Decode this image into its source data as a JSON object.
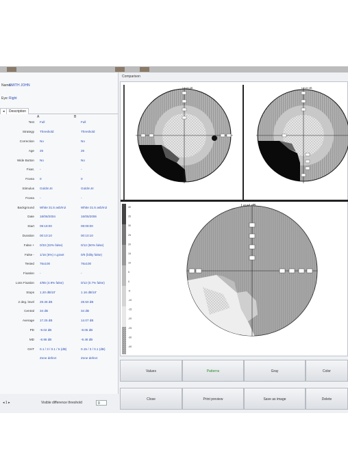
{
  "patient": {
    "name_label": "Name:",
    "name_value": "SMITH JOHN",
    "eye_label": "Eye:",
    "eye_value": "Right"
  },
  "tabs": {
    "first": "◂",
    "description": "Description"
  },
  "columns": {
    "a": "A",
    "b": "B"
  },
  "rows": [
    {
      "key": "Test",
      "a": "Full",
      "b": "Full"
    },
    {
      "key": "Strategy",
      "a": "Threshold",
      "b": "Threshold"
    },
    {
      "key": "Correction",
      "a": "No",
      "b": "No"
    },
    {
      "key": "Age",
      "a": "25",
      "b": "26"
    },
    {
      "key": "Wide Button",
      "a": "No",
      "b": "No"
    },
    {
      "key": "Fixat.",
      "a": "-",
      "b": "-"
    },
    {
      "key": "Fovea",
      "a": "0",
      "b": "0"
    },
    {
      "key": "Stimulus",
      "a": "Goldm.III",
      "b": "Goldm.III"
    },
    {
      "key": "Fovea",
      "a": "-",
      "b": "-"
    },
    {
      "key": "Background",
      "a": "White 31.5 asb/m2",
      "b": "White 31.5 asb/m2"
    },
    {
      "key": "Date",
      "a": "18/06/2004",
      "b": "16/05/2006"
    },
    {
      "key": "Start",
      "a": "09:18:00",
      "b": "09:08:00"
    },
    {
      "key": "Duration",
      "a": "00:10:10",
      "b": "00:10:10"
    },
    {
      "key": "False +",
      "a": "0/33 (33% false)",
      "b": "0/12 (50% false)"
    },
    {
      "key": "False -",
      "a": "1/16 (6%) n.grant",
      "b": "0/6 (bility false)"
    },
    {
      "key": "Tested",
      "a": "76x100",
      "b": "76x100"
    },
    {
      "key": "Fixation",
      "a": "-",
      "b": "-"
    },
    {
      "key": "Loss Fixation",
      "a": "4/85 (4.9% false)",
      "b": "0/12 (0.7% false)"
    },
    {
      "key": "Stops",
      "a": "1.20 dB/10'",
      "b": "1.16 dB/10'"
    },
    {
      "key": "2 deg. level",
      "a": "29.36 dB",
      "b": "28.50 dB"
    },
    {
      "key": "Central",
      "a": "34 dB",
      "b": "34 dB"
    },
    {
      "key": "Average",
      "a": "17.25 dB",
      "b": "14.07 dB"
    },
    {
      "key": "PD",
      "a": "-9.02 dB",
      "b": "-8.05 dB"
    },
    {
      "key": "MD",
      "a": "-8.98 dB",
      "b": "-9.48 dB"
    },
    {
      "key": "GHT",
      "a": "0.1 / 3 / 0.1 / 5 (dB)",
      "b": "0.15 / 3 / 0.1 (dB)"
    },
    {
      "key": "",
      "a": "Zone defect",
      "b": "Zone defect"
    }
  ],
  "left_footer": {
    "nav": "◂ 1 ▸",
    "threshold_label": "Visible difference threshold",
    "threshold_value": "0"
  },
  "comparison_title": "Comparison",
  "charts": {
    "top_left_title": "Level dB",
    "top_right_title": "Level dB",
    "bottom_title": "Level dB"
  },
  "scale_labels": [
    "40",
    "35",
    "30",
    "25",
    "20",
    "15",
    "10",
    "5",
    "0",
    "-5",
    "-10",
    "-15",
    "-20",
    "-25",
    "-30",
    "-40"
  ],
  "buttons_row1": [
    "Values",
    "Patterns",
    "Gray",
    "Color"
  ],
  "buttons_row2": [
    "Close",
    "Print preview",
    "Save as image",
    "Delete"
  ],
  "colors": {
    "accent_green": "#2d8a2d",
    "blue_text": "#2a4fb8"
  }
}
